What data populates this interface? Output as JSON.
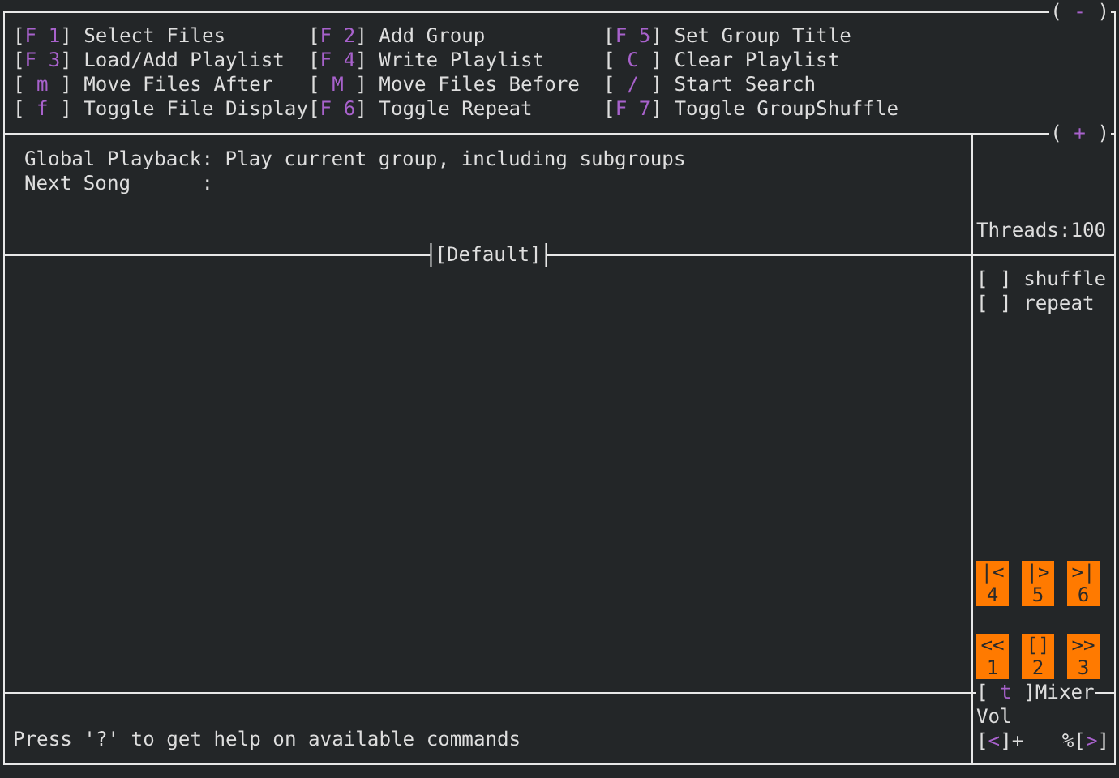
{
  "help_panel": {
    "toggle": {
      "open": "(",
      "key": "-",
      "close": ")"
    },
    "commands": [
      {
        "open": "[",
        "key": "F 1",
        "close": "]",
        "label": "Select Files"
      },
      {
        "open": "[",
        "key": "F 2",
        "close": "]",
        "label": "Add Group"
      },
      {
        "open": "[",
        "key": "F 5",
        "close": "]",
        "label": "Set Group Title"
      },
      {
        "open": "[",
        "key": "F 3",
        "close": "]",
        "label": "Load/Add Playlist"
      },
      {
        "open": "[",
        "key": "F 4",
        "close": "]",
        "label": "Write Playlist"
      },
      {
        "open": "[",
        "key": "C",
        "close": "]",
        "label": "Clear Playlist"
      },
      {
        "open": "[",
        "key": "m",
        "close": "]",
        "label": "Move Files After"
      },
      {
        "open": "[",
        "key": "M",
        "close": "]",
        "label": "Move Files Before"
      },
      {
        "open": "[",
        "key": "/",
        "close": "]",
        "label": "Start Search"
      },
      {
        "open": "[",
        "key": "f",
        "close": "]",
        "label": "Toggle File Display"
      },
      {
        "open": "[",
        "key": "F 6",
        "close": "]",
        "label": "Toggle Repeat"
      },
      {
        "open": "[",
        "key": "F 7",
        "close": "]",
        "label": "Toggle GroupShuffle"
      }
    ]
  },
  "status": {
    "toggle": {
      "open": "(",
      "key": "+",
      "close": ")"
    },
    "lines": [
      "Global Playback: Play current group, including subgroups",
      "Next Song      :"
    ],
    "threads": "Threads:100"
  },
  "playlist": {
    "title": "[Default]"
  },
  "options": [
    {
      "open": "[",
      "close": "]",
      "label": "shuffle",
      "checked": false
    },
    {
      "open": "[",
      "close": "]",
      "label": "repeat",
      "checked": false
    }
  ],
  "transport": [
    [
      {
        "symbol": "|<",
        "number": "4"
      },
      {
        "symbol": "|>",
        "number": "5"
      },
      {
        "symbol": ">|",
        "number": "6"
      }
    ],
    [
      {
        "symbol": "<<",
        "number": "1"
      },
      {
        "symbol": "[]",
        "number": "2"
      },
      {
        "symbol": ">>",
        "number": "3"
      }
    ]
  ],
  "footer": "Press '?' to get help on available commands",
  "mixer": {
    "toggle": {
      "open": "[",
      "key": "t",
      "close": "]"
    },
    "title": "Mixer",
    "vol_label": "Vol",
    "down": {
      "open": "[",
      "key": "<",
      "close": "]"
    },
    "down_sign": "+",
    "up_sign": "%",
    "up": {
      "open": "[",
      "key": ">",
      "close": "]"
    }
  }
}
